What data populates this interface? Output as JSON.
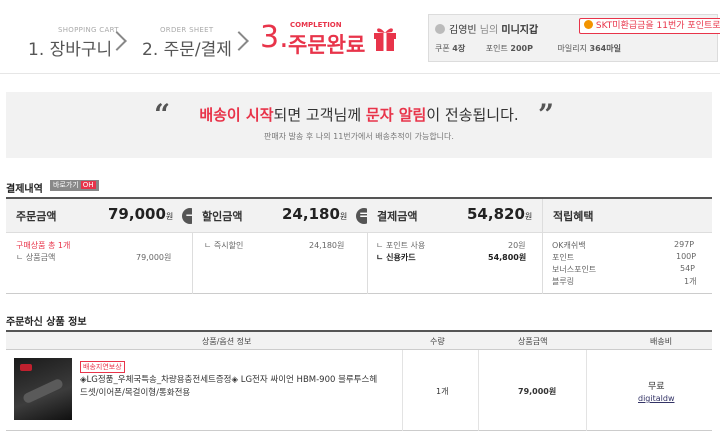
{
  "steps": [
    {
      "small": "SHOPPING CART",
      "label": "1. 장바구니"
    },
    {
      "small": "ORDER SHEET",
      "label": "2. 주문/결제"
    },
    {
      "small": "COMPLETION",
      "num": "3.",
      "label": "주문완료"
    }
  ],
  "user": {
    "name": "김영빈",
    "suffix": "님의",
    "section": "미니지갑",
    "skt": "SKT미환급금을 11번가 포인트로!",
    "coupon_label": "쿠폰",
    "coupon_value": "4장",
    "point_label": "포인트",
    "point_value": "200P",
    "mileage_label": "마일리지",
    "mileage_value": "364마일"
  },
  "notice": {
    "q_open": "“",
    "q_close": "”",
    "red1": "배송이 시작",
    "mid1": "되면 고객님께 ",
    "red2": "문자 알림",
    "mid2": "이 전송됩니다.",
    "sub": "판매자 발송 후 나의 11번가에서 배송추적이 가능합니다."
  },
  "payment": {
    "title": "결제내역",
    "badge": "바로가기",
    "badge_oh": "OH",
    "order_label": "주문금액",
    "order_value": "79,000",
    "won": "원",
    "discount_label": "할인금액",
    "discount_value": "24,180",
    "pay_label": "결제금액",
    "pay_value": "54,820",
    "benefit_label": "적립혜택",
    "minus": "−",
    "equal": "=",
    "order_detail_1": "구매상품 총 1개",
    "order_detail_2": "ㄴ 상품금액",
    "order_detail_2_val": "79,000원",
    "discount_detail": "ㄴ 즉시할인",
    "discount_detail_val": "24,180원",
    "pay_detail_1": "ㄴ 포인트 사용",
    "pay_detail_1_val": "20원",
    "pay_detail_2": "ㄴ 신용카드",
    "pay_detail_2_val": "54,800원",
    "benefits": [
      {
        "label": "OK캐쉬백",
        "value": "297P"
      },
      {
        "label": "포인트",
        "value": "100P"
      },
      {
        "label": "보너스포인트",
        "value": "54P"
      },
      {
        "label": "블루링",
        "value": "1개"
      }
    ]
  },
  "products": {
    "title": "주문하신 상품 정보",
    "col_info": "상품/옵션 정보",
    "col_qty": "수량",
    "col_amount": "상품금액",
    "col_ship": "배송비",
    "item": {
      "tag": "배송지연보상",
      "name": "◈LG정품_우체국특송_차량용충전세트증정◈ LG전자 싸이언 HBM-900 블루투스헤드셋/이어폰/목걸이형/통화전용",
      "qty": "1개",
      "amount": "79,000원",
      "ship": "무료",
      "seller": "digitaldw"
    }
  }
}
